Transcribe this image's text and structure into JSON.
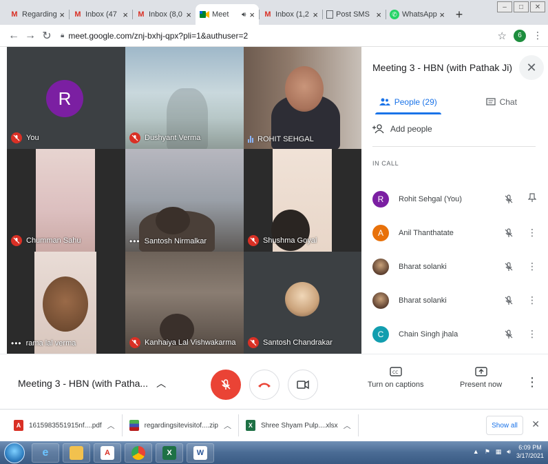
{
  "browser": {
    "tabs": [
      {
        "label": "Regarding",
        "icon": "gmail-icon",
        "active": false
      },
      {
        "label": "Inbox (47",
        "icon": "gmail-icon",
        "active": false
      },
      {
        "label": "Inbox (8,0",
        "icon": "gmail-icon",
        "active": false
      },
      {
        "label": "Meet",
        "icon": "meet-icon",
        "active": true
      },
      {
        "label": "Inbox (1,2",
        "icon": "gmail-icon",
        "active": false
      },
      {
        "label": "Post SMS",
        "icon": "document-icon",
        "active": false
      },
      {
        "label": "WhatsApp",
        "icon": "whatsapp-icon",
        "active": false
      }
    ],
    "url": "meet.google.com/znj-bxhj-qpx?pli=1&authuser=2",
    "profile_initial": "6"
  },
  "grid": {
    "tiles": [
      {
        "name": "You",
        "avatar_initial": "R",
        "status": "muted"
      },
      {
        "name": "Dushyant Verma",
        "status": "muted"
      },
      {
        "name": "ROHIT SEHGAL",
        "status": "speaking"
      },
      {
        "name": "Chumman Sahu",
        "status": "muted"
      },
      {
        "name": "Santosh Nirmalkar",
        "status": "more"
      },
      {
        "name": "Shushma Goyal",
        "status": "muted"
      },
      {
        "name": "rama lal verma",
        "status": "more"
      },
      {
        "name": "Kanhaiya Lal Vishwakarma",
        "status": "muted"
      },
      {
        "name": "Santosh Chandrakar",
        "status": "muted"
      }
    ]
  },
  "panel": {
    "title": "Meeting 3 - HBN (with Pathak Ji)",
    "tab_people": "People (29)",
    "tab_chat": "Chat",
    "add_people": "Add people",
    "in_call_label": "IN CALL",
    "participants": [
      {
        "name": "Rohit Sehgal (You)",
        "initial": "R",
        "color": "#7b1fa2",
        "action": "pin"
      },
      {
        "name": "Anil Thanthatate",
        "initial": "A",
        "color": "#e8710a",
        "action": "more"
      },
      {
        "name": "Bharat solanki",
        "initial": "",
        "color": "#8d6e63",
        "action": "more"
      },
      {
        "name": "Bharat solanki",
        "initial": "",
        "color": "#8d6e63",
        "action": "more"
      },
      {
        "name": "Chain Singh jhala",
        "initial": "C",
        "color": "#129eaf",
        "action": "more"
      }
    ]
  },
  "controls": {
    "meeting_title": "Meeting 3 - HBN (with Patha...",
    "captions_label": "Turn on captions",
    "present_label": "Present now"
  },
  "downloads": {
    "items": [
      {
        "name": "1615983551915nf....pdf",
        "type": "pdf"
      },
      {
        "name": "regardingsitevisitof....zip",
        "type": "zip"
      },
      {
        "name": "Shree Shyam Pulp....xlsx",
        "type": "xlsx"
      }
    ],
    "show_all": "Show all"
  },
  "taskbar": {
    "time": "6:09 PM",
    "date": "3/17/2021"
  },
  "colors": {
    "meet_red": "#ea4335",
    "accent_blue": "#1a73e8",
    "grid_bg": "#202124"
  }
}
